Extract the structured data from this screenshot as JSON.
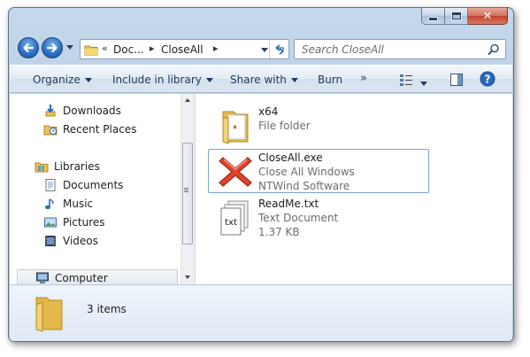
{
  "window": {
    "address": {
      "segments": [
        "Doc...",
        "CloseAll"
      ],
      "overflow_glyph": "«",
      "separator_glyph": "▸"
    },
    "search": {
      "placeholder": "Search CloseAll"
    }
  },
  "toolbar": {
    "organize": "Organize",
    "include": "Include in library",
    "share": "Share with",
    "burn": "Burn",
    "more": "»"
  },
  "nav": {
    "favorites": [
      {
        "label": "Downloads",
        "icon": "downloads-icon"
      },
      {
        "label": "Recent Places",
        "icon": "recent-places-icon"
      }
    ],
    "libraries": {
      "label": "Libraries",
      "items": [
        {
          "label": "Documents",
          "icon": "documents-icon"
        },
        {
          "label": "Music",
          "icon": "music-icon"
        },
        {
          "label": "Pictures",
          "icon": "pictures-icon"
        },
        {
          "label": "Videos",
          "icon": "videos-icon"
        }
      ]
    },
    "computer": {
      "label": "Computer"
    }
  },
  "files": [
    {
      "name": "x64",
      "line2": "File folder",
      "line3": "",
      "icon": "folder-icon"
    },
    {
      "name": "CloseAll.exe",
      "line2": "Close All Windows",
      "line3": "NTWind Software",
      "icon": "red-x-icon"
    },
    {
      "name": "ReadMe.txt",
      "line2": "Text Document",
      "line3": "1.37 KB",
      "icon": "text-document-icon"
    }
  ],
  "details": {
    "count": "3 items"
  },
  "colors": {
    "accent": "#2a6cc4",
    "selection_border": "#7da2ce",
    "close_red": "#c0432b"
  }
}
